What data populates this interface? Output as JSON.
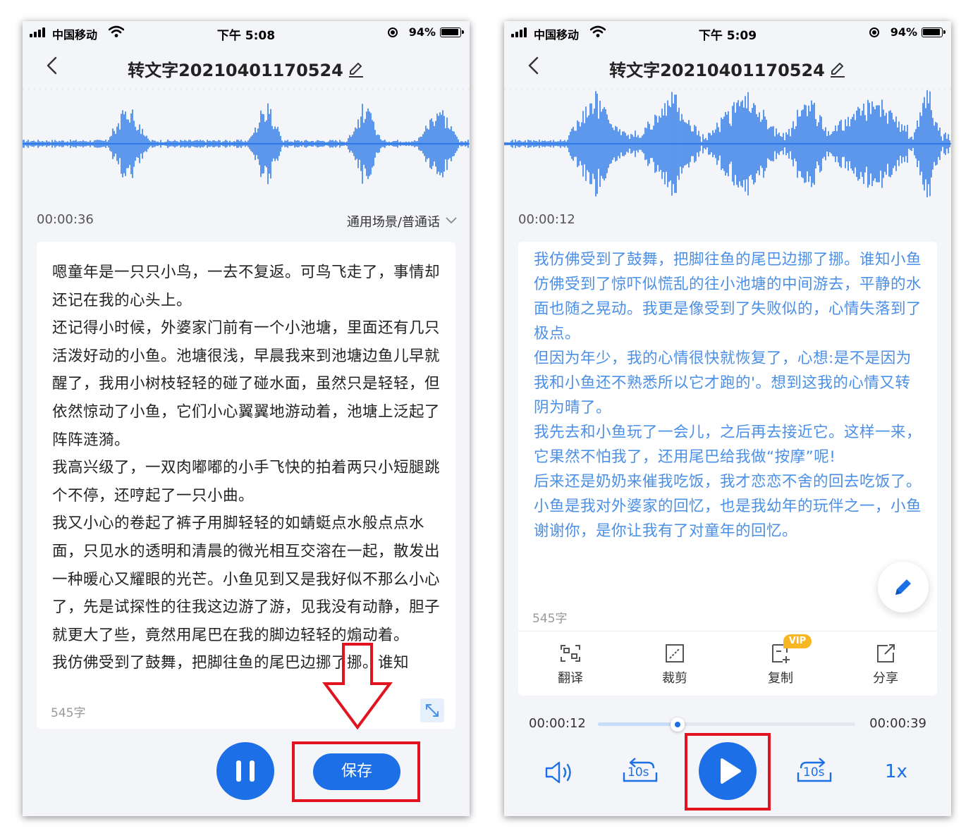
{
  "theme": {
    "accent": "#1c6fe6",
    "highlight": "#e0131f",
    "transcript_blue": "#4a8fe8",
    "vip": "#f6b722"
  },
  "left": {
    "status": {
      "carrier": "中国移动",
      "time": "下午 5:08",
      "battery": "94%"
    },
    "title": "转文字20210401170524",
    "elapsed": "00:00:36",
    "scene": "通用场景/普通话",
    "paragraphs": [
      "嗯童年是一只只小鸟，一去不复返。可鸟飞走了，事情却还记在我的心头上。",
      "还记得小时候，外婆家门前有一个小池塘，里面还有几只活泼好动的小鱼。池塘很浅，早晨我来到池塘边鱼儿早就醒了，我用小树枝轻轻的碰了碰水面，虽然只是轻轻，但依然惊动了小鱼，它们小心翼翼地游动着，池塘上泛起了阵阵涟漪。",
      "我高兴级了，一双肉嘟嘟的小手飞快的拍着两只小短腿跳个不停，还哼起了一只小曲。",
      "我又小心的卷起了裤子用脚轻轻的如蜻蜓点水般点点水面，只见水的透明和清晨的微光相互交溶在一起，散发出一种暖心又耀眼的光芒。小鱼见到又是我好似不那么小心了，先是试探性的往我这边游了游，见我没有动静，胆子就更大了些，竟然用尾巴在我的脚边轻轻的煽动着。",
      "我仿佛受到了鼓舞，把脚往鱼的尾巴边挪了挪。谁知"
    ],
    "char_count": "545字",
    "save_label": "保存"
  },
  "right": {
    "status": {
      "carrier": "中国移动",
      "time": "下午 5:09",
      "battery": "94%"
    },
    "title": "转文字20210401170524",
    "elapsed": "00:00:12",
    "paragraphs": [
      "我仿佛受到了鼓舞，把脚往鱼的尾巴边挪了挪。谁知小鱼仿佛受到了惊吓似慌乱的往小池塘的中间游去，平静的水面也随之晃动。我更是像受到了失败似的，心情失落到了极点。",
      "但因为年少，我的心情很快就恢复了，心想:是不是因为我和小鱼还不熟悉所以它才跑的'。想到这我的心情又转阴为晴了。",
      "我先去和小鱼玩了一会儿，之后再去接近它。这样一来，它果然不怕我了，还用尾巴给我做“按摩”呢!",
      "后来还是奶奶来催我吃饭，我才恋恋不舍的回去吃饭了。",
      "小鱼是我对外婆家的回忆，也是我幼年的玩伴之一，小鱼谢谢你，是你让我有了对童年的回忆。"
    ],
    "char_count": "545字",
    "tools": {
      "translate": "翻译",
      "crop": "裁剪",
      "copy": "复制",
      "share": "分享",
      "vip_badge": "VIP"
    },
    "player": {
      "current": "00:00:12",
      "total": "00:00:39",
      "progress": 0.31,
      "rewind_label": "10s",
      "forward_label": "10s",
      "speed": "1x"
    }
  }
}
